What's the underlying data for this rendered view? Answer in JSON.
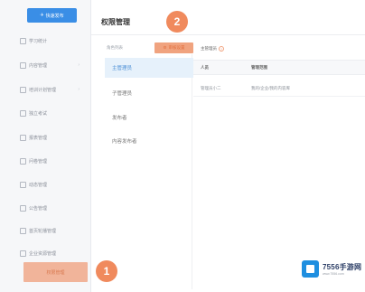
{
  "sidebar": {
    "publish_label": "快速发布",
    "items": [
      {
        "label": "学习统计"
      },
      {
        "label": "内容管理",
        "chevron": "›"
      },
      {
        "label": "培训计划管理",
        "chevron": "›"
      },
      {
        "label": "独立考试"
      },
      {
        "label": "报表管理"
      },
      {
        "label": "问卷管理"
      },
      {
        "label": "动态管理"
      },
      {
        "label": "公告管理"
      },
      {
        "label": "首页轮播管理"
      },
      {
        "label": "企业资源管理"
      }
    ],
    "active_label": "权限管理"
  },
  "badges": {
    "one": "1",
    "two": "2"
  },
  "header": {
    "title": "权限管理"
  },
  "tabs": {
    "roles": "角色列表",
    "approve": "审核设置"
  },
  "roles": [
    {
      "label": "主管理员",
      "active": true
    },
    {
      "label": "子管理员",
      "active": false
    },
    {
      "label": "发布者",
      "active": false
    },
    {
      "label": "内容发布者",
      "active": false
    }
  ],
  "right": {
    "title": "主管理员",
    "columns": [
      "人员",
      "管理范围"
    ],
    "row": [
      "管理员小二",
      "我的/企业/我的内容库"
    ]
  },
  "watermark": {
    "name": "7556手游网",
    "url": "www.7556.com"
  },
  "colors": {
    "accent_blue": "#3a8ee6",
    "highlight_orange": "#f08a5d",
    "active_role_bg": "#e6f1fb"
  }
}
